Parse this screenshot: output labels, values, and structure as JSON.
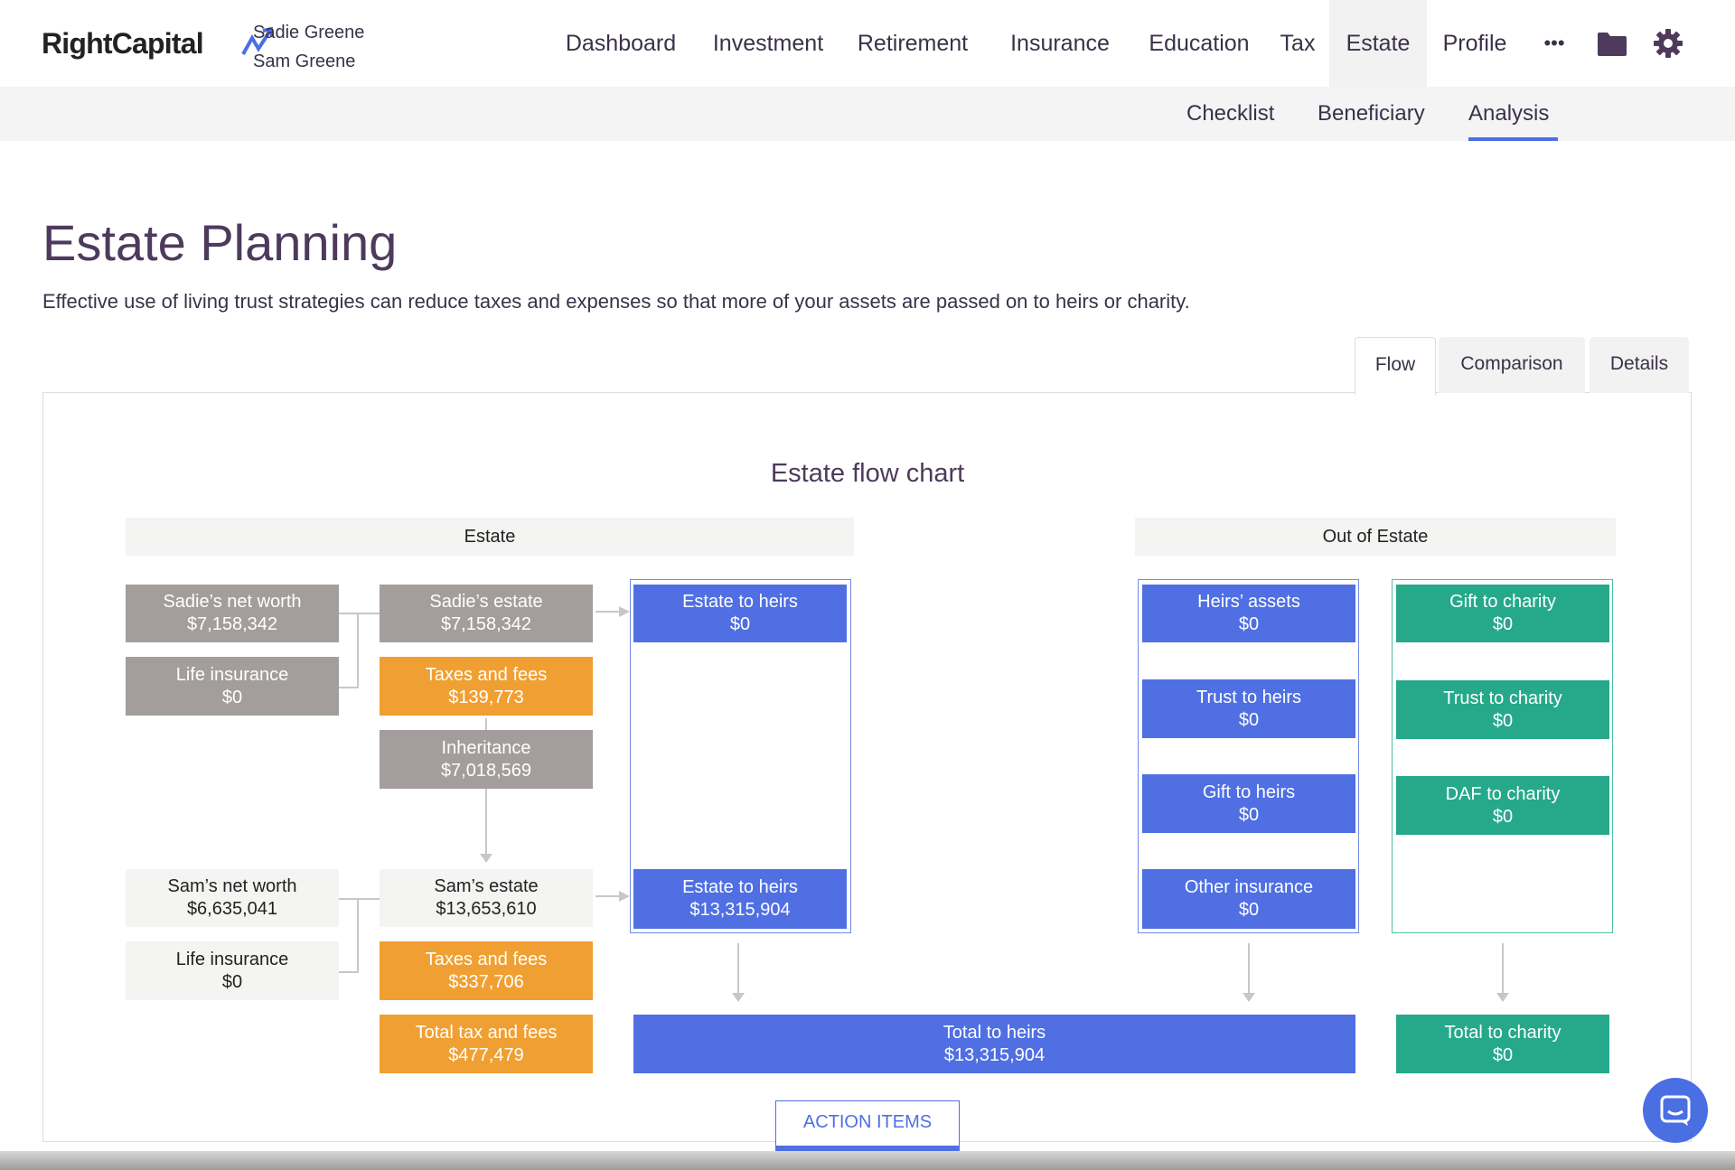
{
  "header": {
    "logo_text": "RightCapital",
    "client_1": "Sadie Greene",
    "client_2": "Sam Greene"
  },
  "nav": {
    "dashboard": "Dashboard",
    "investment": "Investment",
    "retirement": "Retirement",
    "insurance": "Insurance",
    "education": "Education",
    "tax": "Tax",
    "estate": "Estate",
    "profile": "Profile",
    "more": "•••"
  },
  "subnav": {
    "checklist": "Checklist",
    "beneficiary": "Beneficiary",
    "analysis": "Analysis"
  },
  "page": {
    "title": "Estate Planning",
    "description": "Effective use of living trust strategies can reduce taxes and expenses so that more of your assets are passed on to heirs or charity."
  },
  "tabs": {
    "flow": "Flow",
    "comparison": "Comparison",
    "details": "Details"
  },
  "chart": {
    "title": "Estate flow chart",
    "estate_header": "Estate",
    "out_header": "Out of Estate",
    "sadie_net_worth": {
      "label": "Sadie’s net worth",
      "value": "$7,158,342"
    },
    "sadie_life_insurance": {
      "label": "Life insurance",
      "value": "$0"
    },
    "sadie_estate": {
      "label": "Sadie’s estate",
      "value": "$7,158,342"
    },
    "sadie_taxes": {
      "label": "Taxes and fees",
      "value": "$139,773"
    },
    "inheritance": {
      "label": "Inheritance",
      "value": "$7,018,569"
    },
    "estate_to_heirs_1": {
      "label": "Estate to heirs",
      "value": "$0"
    },
    "sam_net_worth": {
      "label": "Sam’s net worth",
      "value": "$6,635,041"
    },
    "sam_life_insurance": {
      "label": "Life insurance",
      "value": "$0"
    },
    "sam_estate": {
      "label": "Sam’s estate",
      "value": "$13,653,610"
    },
    "sam_taxes": {
      "label": "Taxes and fees",
      "value": "$337,706"
    },
    "total_tax": {
      "label": "Total tax and fees",
      "value": "$477,479"
    },
    "estate_to_heirs_2": {
      "label": "Estate to heirs",
      "value": "$13,315,904"
    },
    "heirs_assets": {
      "label": "Heirs’ assets",
      "value": "$0"
    },
    "trust_to_heirs": {
      "label": "Trust to heirs",
      "value": "$0"
    },
    "gift_to_heirs": {
      "label": "Gift to heirs",
      "value": "$0"
    },
    "other_insurance": {
      "label": "Other insurance",
      "value": "$0"
    },
    "gift_to_charity": {
      "label": "Gift to charity",
      "value": "$0"
    },
    "trust_to_charity": {
      "label": "Trust to charity",
      "value": "$0"
    },
    "daf_to_charity": {
      "label": "DAF to charity",
      "value": "$0"
    },
    "total_to_heirs": {
      "label": "Total to heirs",
      "value": "$13,315,904"
    },
    "total_to_charity": {
      "label": "Total to charity",
      "value": "$0"
    }
  },
  "action_items": "ACTION ITEMS",
  "colors": {
    "blue": "#4f6fe2",
    "green": "#25a98a",
    "orange": "#f0a032",
    "gray": "#a39e9b"
  }
}
